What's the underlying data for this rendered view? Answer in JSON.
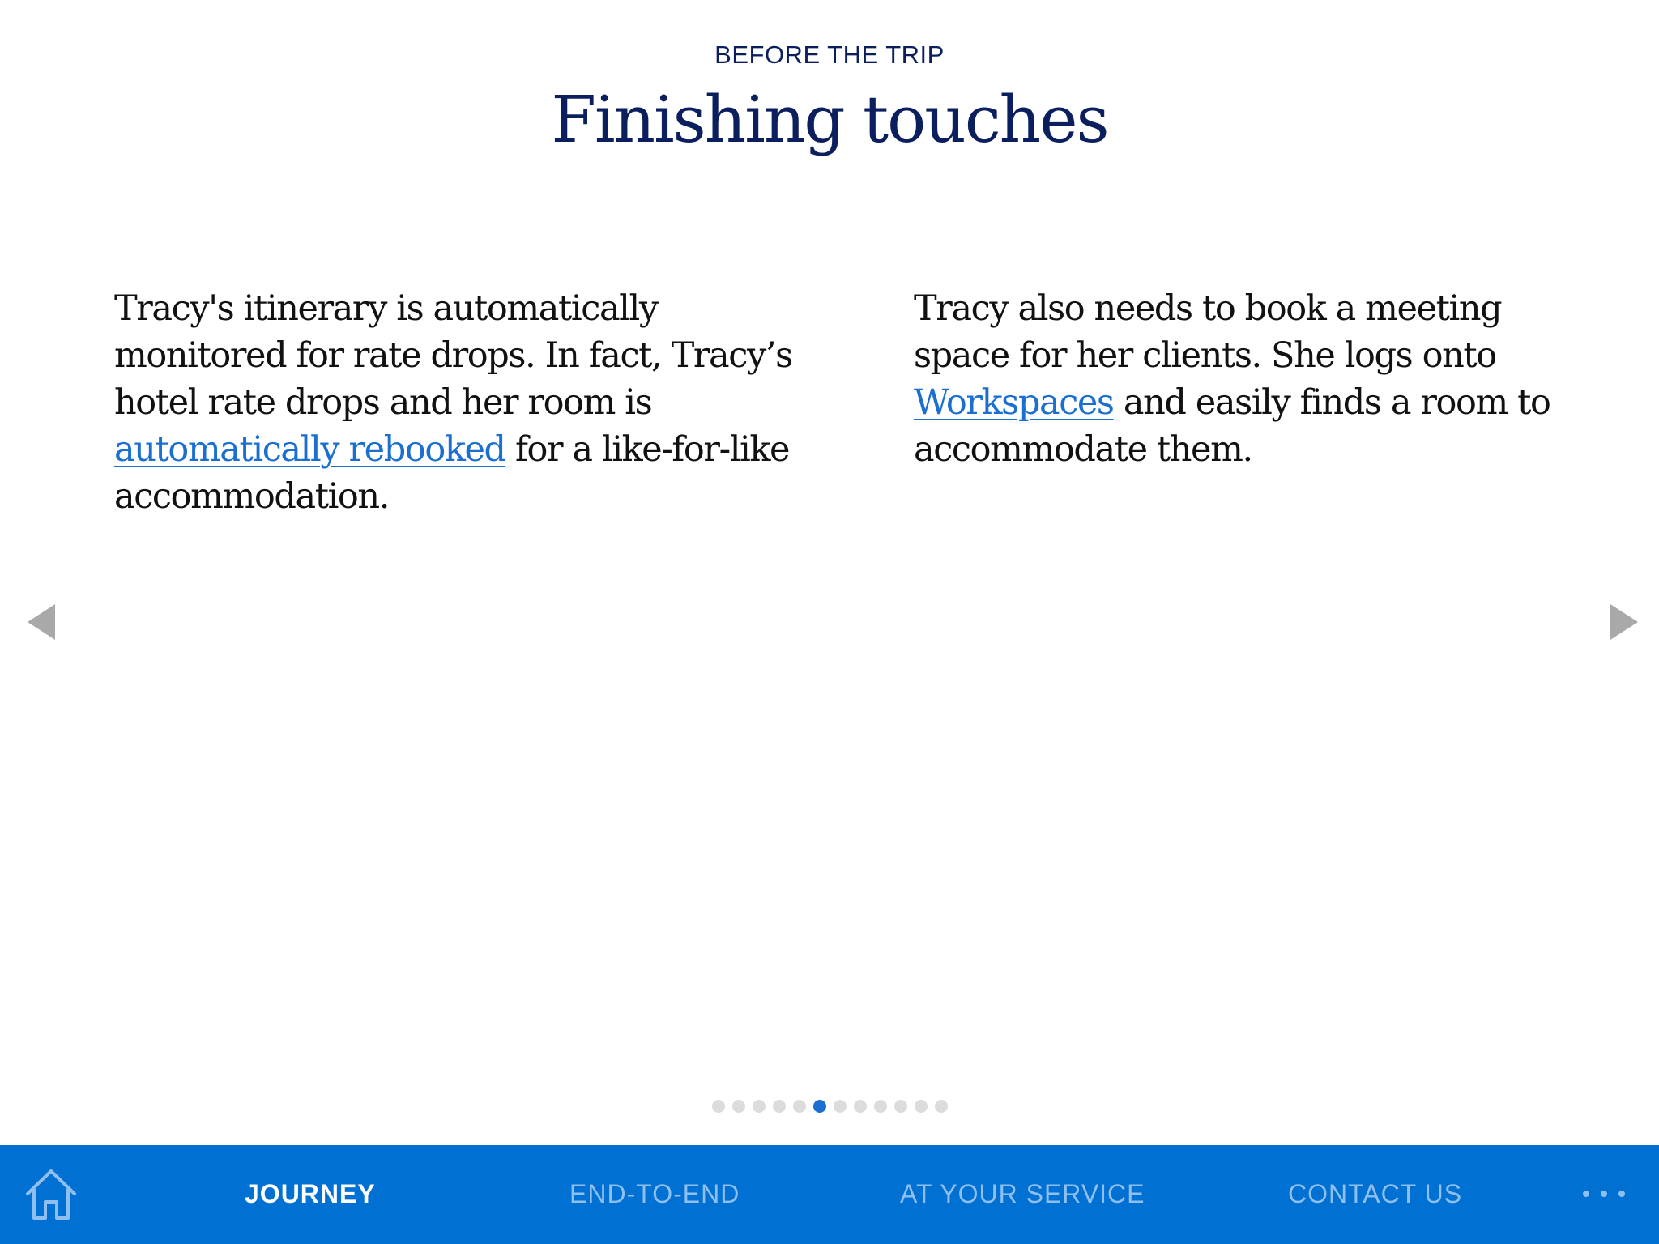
{
  "header": {
    "eyebrow": "BEFORE THE TRIP",
    "title": "Finishing touches"
  },
  "content": {
    "left": {
      "text_before_link": "Tracy's itinerary is automatically monitored for rate drops. In fact, Tracy’s hotel rate drops and her room is ",
      "link": "automatically rebooked",
      "text_after_link": " for a like-for-like accommodation."
    },
    "right": {
      "text_before_link": "Tracy also needs to book a meeting space for her clients. She logs onto ",
      "link": "Workspaces",
      "text_after_link": " and easily finds a room to accommodate them."
    }
  },
  "pager": {
    "total": 12,
    "active_index": 5
  },
  "navbar": {
    "items": [
      {
        "label": "JOURNEY",
        "active": true
      },
      {
        "label": "END-TO-END",
        "active": false
      },
      {
        "label": "AT YOUR SERVICE",
        "active": false
      },
      {
        "label": "CONTACT US",
        "active": false
      }
    ],
    "home_icon": "home-icon",
    "more_icon": "more-icon"
  },
  "colors": {
    "title": "#0b1f5e",
    "link": "#1a6fd0",
    "navbar_bg": "#0070d2",
    "nav_inactive": "#8ebfee",
    "nav_active": "#ffffff",
    "arrow": "#a9a9a9"
  }
}
